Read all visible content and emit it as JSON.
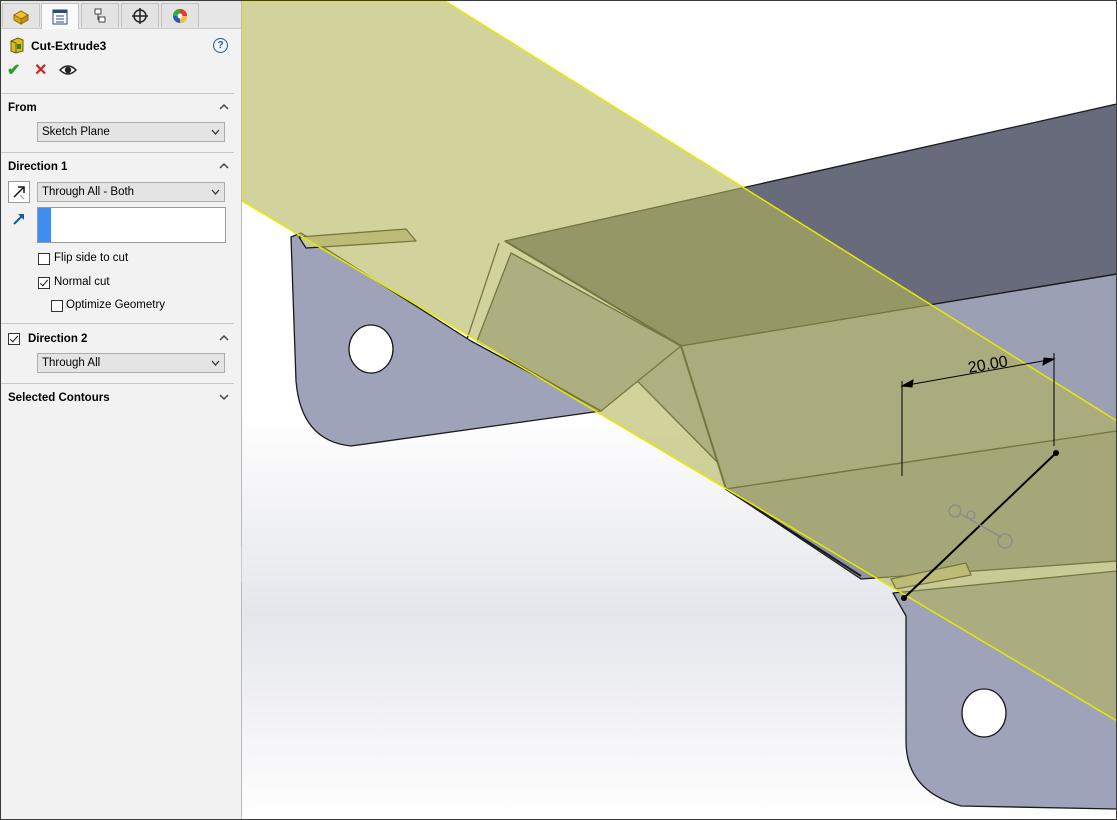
{
  "feature": {
    "title": "Cut-Extrude3"
  },
  "from": {
    "header": "From",
    "end_condition": "Sketch Plane"
  },
  "direction1": {
    "header": "Direction 1",
    "end_condition": "Through All - Both",
    "flip_side_to_cut": "Flip side to cut",
    "flip_checked": false,
    "normal_cut": "Normal cut",
    "normal_checked": true,
    "optimize_geometry": "Optimize Geometry",
    "optimize_checked": false
  },
  "direction2": {
    "header": "Direction 2",
    "checked": true,
    "end_condition": "Through All"
  },
  "selected_contours": {
    "header": "Selected Contours"
  },
  "viewport": {
    "dimension_value": "20.00"
  },
  "colors": {
    "panel_bg": "#f2f2f2",
    "part_face": "#9aa0b8",
    "plane_fill": "#b4b45a",
    "plane_edge": "#e8e800",
    "ok_green": "#2d9b2d",
    "cancel_red": "#d42020"
  }
}
